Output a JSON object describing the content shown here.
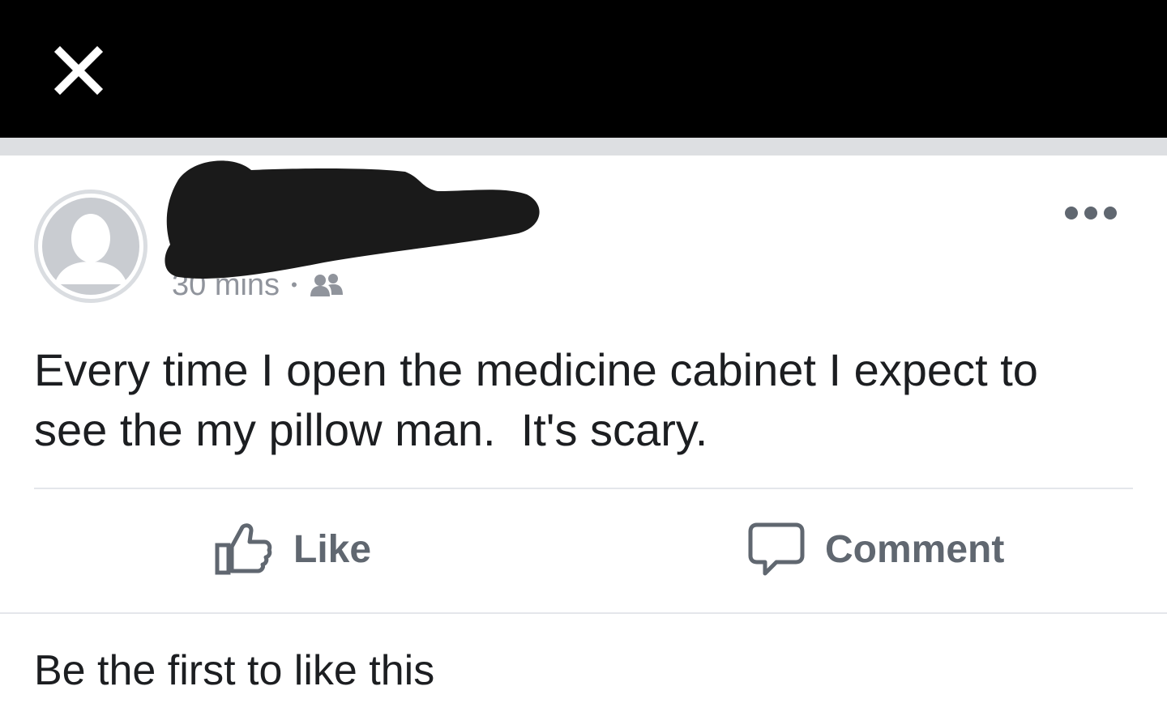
{
  "header": {
    "close_icon": "close-icon",
    "background_color": "#000000"
  },
  "post": {
    "author_name": "",
    "timestamp": "30 mins",
    "audience_icon": "friends-icon",
    "more_icon": "more-options-icon",
    "text": "Every time I open the medicine cabinet I expect to\nsee the my pillow man.  It's scary."
  },
  "actions": {
    "like_label": "Like",
    "like_icon": "thumbs-up-icon",
    "comment_label": "Comment",
    "comment_icon": "speech-bubble-icon"
  },
  "reactions": {
    "summary": "Be the first to like this"
  },
  "colors": {
    "text_primary": "#1c1e21",
    "text_secondary": "#606770",
    "divider": "#dddfe2",
    "redaction": "#1a1a1a"
  }
}
